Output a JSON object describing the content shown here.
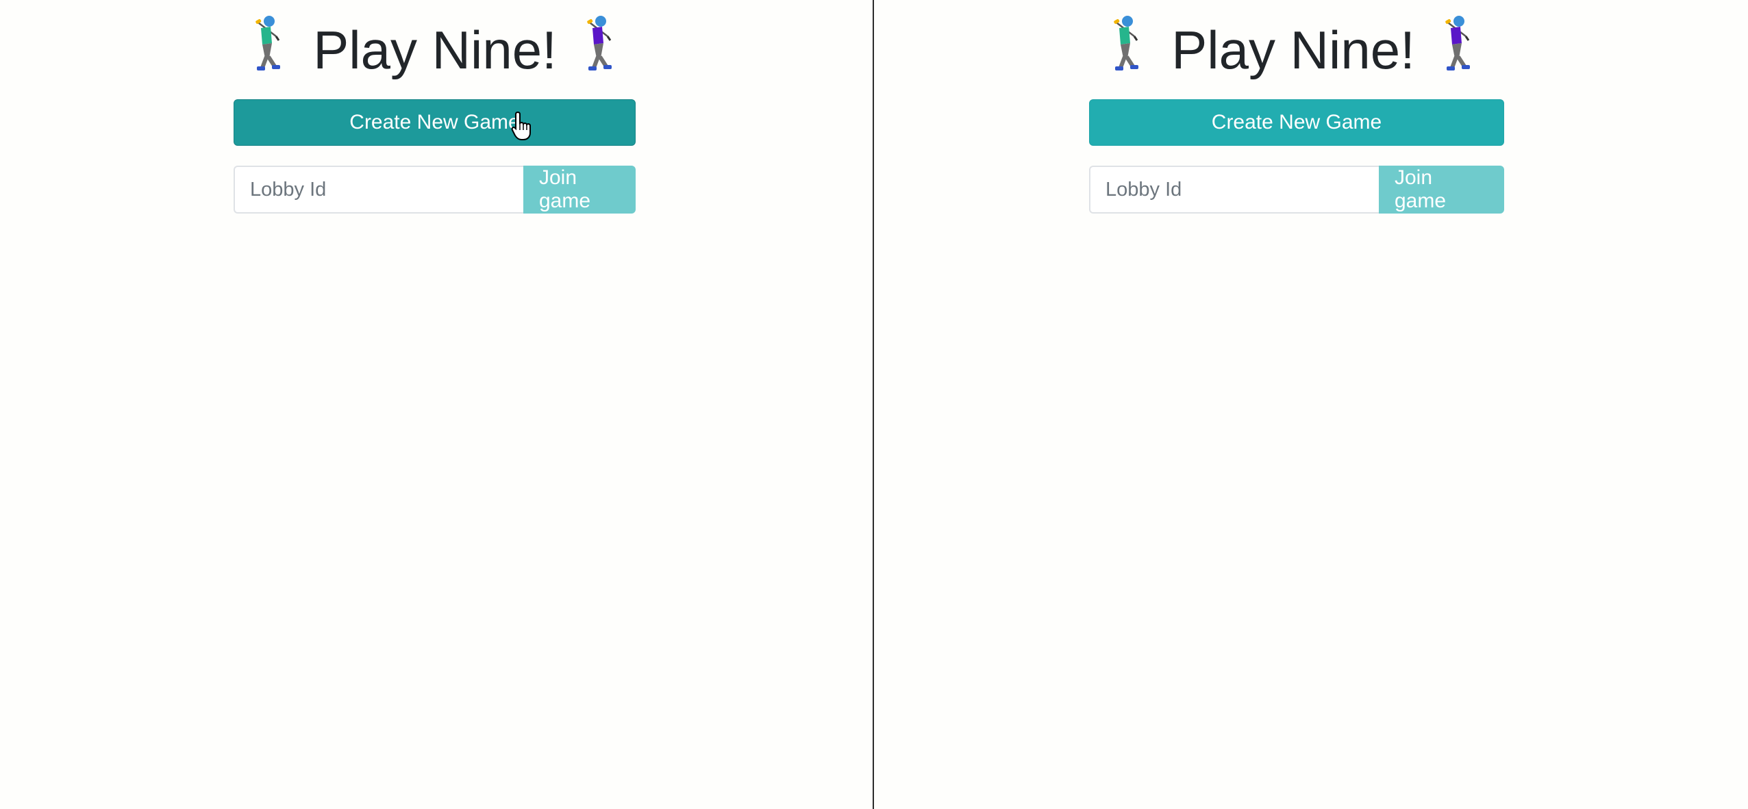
{
  "left_pane": {
    "title": "Play Nine!",
    "title_icon_left": "golfer-icon",
    "title_icon_right": "golfer-icon",
    "create_button_label": "Create New Game",
    "lobby_input_placeholder": "Lobby Id",
    "lobby_input_value": "",
    "join_button_label": "Join game",
    "create_button_state": "hover"
  },
  "right_pane": {
    "title": "Play Nine!",
    "title_icon_left": "golfer-icon",
    "title_icon_right": "golfer-icon",
    "create_button_label": "Create New Game",
    "lobby_input_placeholder": "Lobby Id",
    "lobby_input_value": "",
    "join_button_label": "Join game",
    "create_button_state": "normal"
  },
  "colors": {
    "background": "#fefefc",
    "primary": "#22adb0",
    "primary_hover": "#1d9a9b",
    "join_button": "#6fcbcc",
    "title_text": "#212529",
    "golfer_a_shirt": "#26b58c",
    "golfer_b_shirt": "#5a16c8"
  },
  "cursor_icon": "hand-pointer-icon"
}
